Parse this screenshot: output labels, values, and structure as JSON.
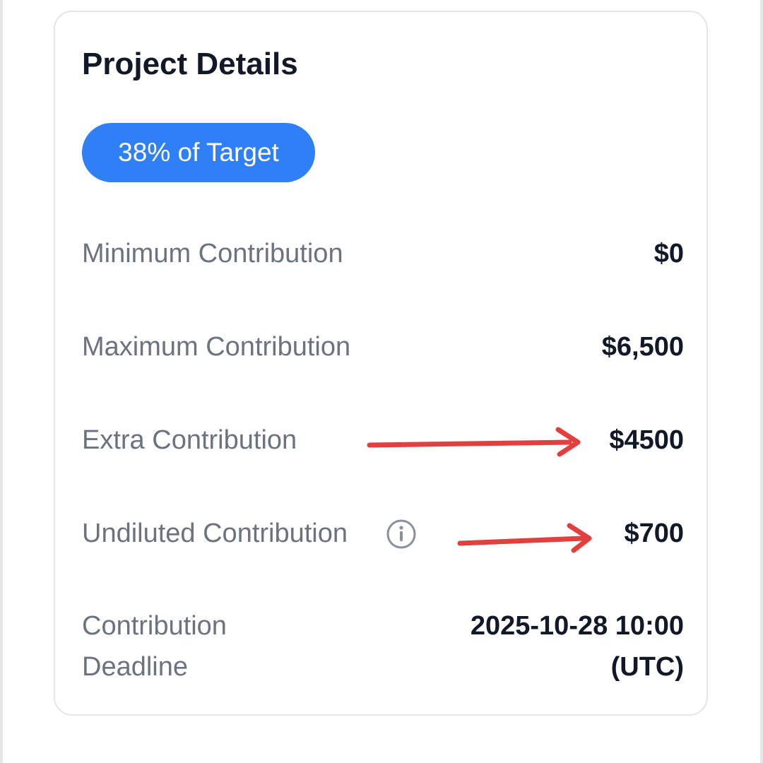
{
  "card": {
    "title": "Project Details",
    "badge": "38% of Target",
    "rows": [
      {
        "label": "Minimum Contribution",
        "value": "$0"
      },
      {
        "label": "Maximum Contribution",
        "value": "$6,500"
      },
      {
        "label": "Extra Contribution",
        "value": "$4500"
      },
      {
        "label": "Undiluted Contribution",
        "value": "$700"
      },
      {
        "label": "Contribution Deadline",
        "value": "2025-10-28 10:00 (UTC)"
      }
    ]
  },
  "icons": {
    "info": "info-circle-icon",
    "annotation_arrow": "red-arrow-icon"
  },
  "colors": {
    "badge_bg": "#2f7ff7",
    "label_text": "#6b7280",
    "value_text": "#111827",
    "annotation": "#e43f3f"
  }
}
